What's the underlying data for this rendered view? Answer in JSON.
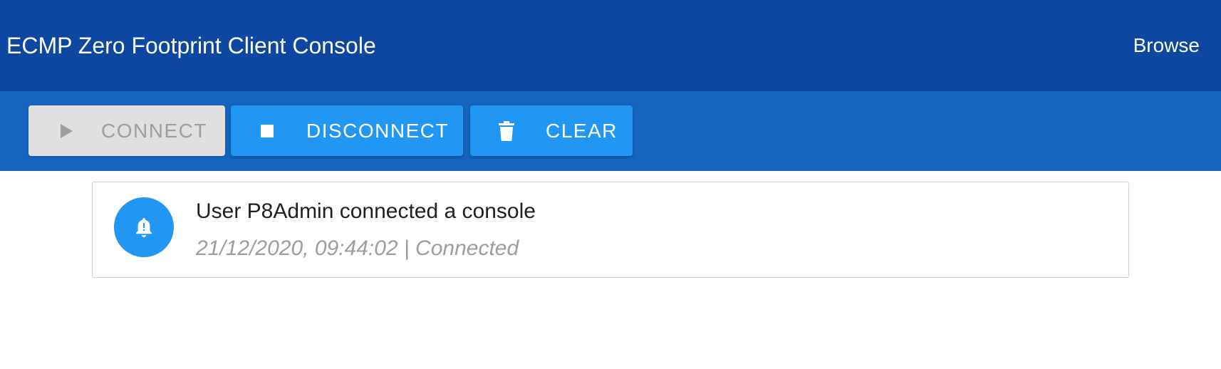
{
  "header": {
    "title": "ECMP Zero Footprint Client Console",
    "browse_label": "Browse"
  },
  "toolbar": {
    "connect": {
      "label": "CONNECT",
      "icon": "play-icon",
      "disabled": true
    },
    "disconnect": {
      "label": "DISCONNECT",
      "icon": "stop-icon"
    },
    "clear": {
      "label": "CLEAR",
      "icon": "trash-icon"
    }
  },
  "messages": [
    {
      "icon": "bell-alert-icon",
      "text": "User P8Admin connected a console",
      "meta": "21/12/2020, 09:44:02 | Connected"
    }
  ],
  "colors": {
    "app_bar": "#0d47a1",
    "toolbar": "#1565c0",
    "primary_button": "#2196f3",
    "disabled_button": "#e0e0e0",
    "disabled_text": "#9e9e9e"
  }
}
